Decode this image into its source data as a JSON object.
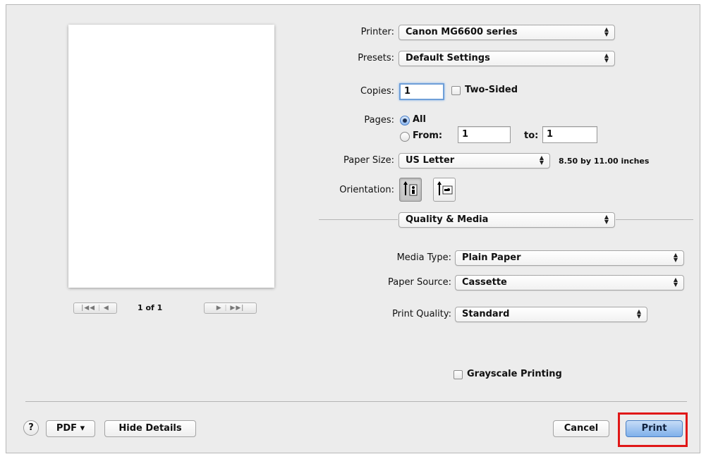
{
  "printer": {
    "label": "Printer:",
    "value": "Canon MG6600 series"
  },
  "presets": {
    "label": "Presets:",
    "value": "Default Settings"
  },
  "copies": {
    "label": "Copies:",
    "value": "1",
    "two_sided_label": "Two-Sided",
    "two_sided_checked": false
  },
  "pages": {
    "label": "Pages:",
    "all_label": "All",
    "from_label": "From:",
    "from_value": "1",
    "to_label": "to:",
    "to_value": "1",
    "selected": "All"
  },
  "paper_size": {
    "label": "Paper Size:",
    "value": "US Letter",
    "dimensions": "8.50 by 11.00 inches"
  },
  "orientation": {
    "label": "Orientation:",
    "selected": "portrait",
    "options": [
      "portrait-icon",
      "landscape-icon"
    ]
  },
  "section_popup": {
    "value": "Quality & Media"
  },
  "media_type": {
    "label": "Media Type:",
    "value": "Plain Paper"
  },
  "paper_source": {
    "label": "Paper Source:",
    "value": "Cassette"
  },
  "print_quality": {
    "label": "Print Quality:",
    "value": "Standard"
  },
  "grayscale": {
    "label": "Grayscale Printing",
    "checked": false
  },
  "preview_nav": {
    "page_indicator": "1 of 1",
    "first_icon": "first-page-icon",
    "prev_icon": "prev-page-icon",
    "next_icon": "next-page-icon",
    "last_icon": "last-page-icon"
  },
  "footer": {
    "help_label": "?",
    "pdf_label": "PDF ▾",
    "hide_details_label": "Hide Details",
    "cancel_label": "Cancel",
    "print_label": "Print"
  },
  "highlight_color": "#e01818",
  "accent_color": "#7fb0ea"
}
